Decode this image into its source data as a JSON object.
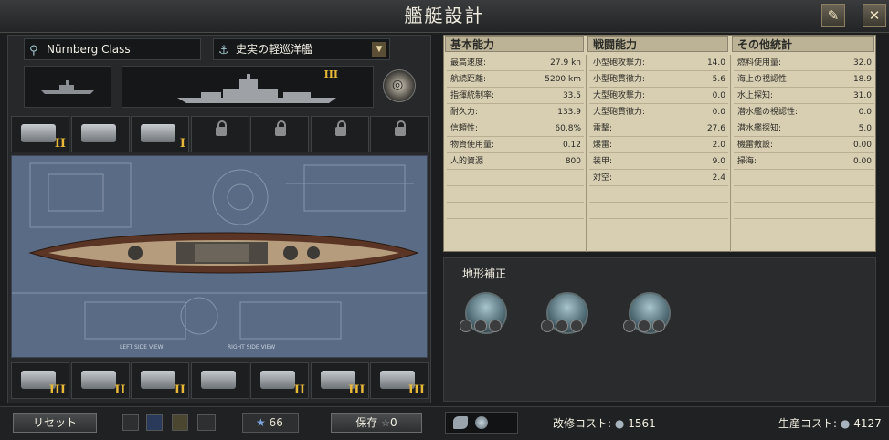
{
  "window": {
    "title": "艦艇設計"
  },
  "design": {
    "name": "Nürnberg Class",
    "role": "史実の軽巡洋艦"
  },
  "hull": {
    "tier": "III"
  },
  "top_modules": [
    {
      "icon": "ship-guns-icon",
      "tier": "II",
      "locked": false
    },
    {
      "icon": "fuel-tank-icon",
      "tier": "",
      "locked": false
    },
    {
      "icon": "seaplane-catapult-icon",
      "tier": "I",
      "locked": false
    },
    {
      "icon": "lock-icon",
      "tier": "",
      "locked": true
    },
    {
      "icon": "lock-icon",
      "tier": "",
      "locked": true
    },
    {
      "icon": "lock-icon",
      "tier": "",
      "locked": true
    },
    {
      "icon": "lock-icon",
      "tier": "",
      "locked": true
    }
  ],
  "bottom_modules": [
    {
      "icon": "main-battery-icon",
      "tier": "III"
    },
    {
      "icon": "aa-gun-icon",
      "tier": "II"
    },
    {
      "icon": "torpedo-launcher-icon",
      "tier": "II"
    },
    {
      "icon": "radar-add-icon",
      "tier": ""
    },
    {
      "icon": "engine-icon",
      "tier": "II"
    },
    {
      "icon": "secondary-battery-icon",
      "tier": "III"
    },
    {
      "icon": "armor-icon",
      "tier": "III"
    }
  ],
  "stats": {
    "basic": {
      "header": "基本能力",
      "rows": [
        {
          "k": "最高速度:",
          "v": "27.9 kn"
        },
        {
          "k": "航続距離:",
          "v": "5200 km"
        },
        {
          "k": "指揮統制率:",
          "v": "33.5"
        },
        {
          "k": "耐久力:",
          "v": "133.9"
        },
        {
          "k": "信頼性:",
          "v": "60.8%"
        },
        {
          "k": "物資使用量:",
          "v": "0.12"
        },
        {
          "k": "人的資源",
          "v": "800"
        }
      ]
    },
    "combat": {
      "header": "戦闘能力",
      "rows": [
        {
          "k": "小型砲攻撃力:",
          "v": "14.0"
        },
        {
          "k": "小型砲貫徹力:",
          "v": "5.6"
        },
        {
          "k": "大型砲攻撃力:",
          "v": "0.0"
        },
        {
          "k": "大型砲貫徹力:",
          "v": "0.0"
        },
        {
          "k": "雷撃:",
          "v": "27.6"
        },
        {
          "k": "爆雷:",
          "v": "2.0"
        },
        {
          "k": "装甲:",
          "v": "9.0"
        },
        {
          "k": "対空:",
          "v": "2.4"
        }
      ]
    },
    "other": {
      "header": "その他統計",
      "rows": [
        {
          "k": "燃料使用量:",
          "v": "32.0"
        },
        {
          "k": "海上の視認性:",
          "v": "18.9"
        },
        {
          "k": "水上探知:",
          "v": "31.0"
        },
        {
          "k": "潜水艦の視認性:",
          "v": "0.0"
        },
        {
          "k": "潜水艦探知:",
          "v": "5.0"
        },
        {
          "k": "機雷敷設:",
          "v": "0.00"
        },
        {
          "k": "掃海:",
          "v": "0.00"
        }
      ]
    }
  },
  "terrain": {
    "title": "地形補正"
  },
  "bottom": {
    "reset": "リセット",
    "xp": "66",
    "save": "保存",
    "save_count": "0",
    "refit_cost_label": "改修コスト:",
    "refit_cost": "1561",
    "production_cost_label": "生産コスト:",
    "production_cost": "4127"
  }
}
